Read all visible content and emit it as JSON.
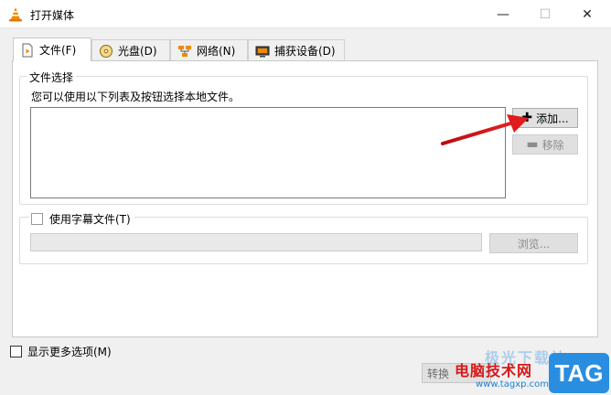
{
  "window": {
    "title": "打开媒体",
    "minimize_glyph": "—",
    "maximize_glyph": "☐",
    "close_glyph": "✕"
  },
  "tabs": [
    {
      "label": "文件(F)",
      "icon": "file-play-icon",
      "active": true
    },
    {
      "label": "光盘(D)",
      "icon": "disc-icon",
      "active": false
    },
    {
      "label": "网络(N)",
      "icon": "network-icon",
      "active": false
    },
    {
      "label": "捕获设备(D)",
      "icon": "capture-device-icon",
      "active": false
    }
  ],
  "file_selection": {
    "group_title": "文件选择",
    "description": "您可以使用以下列表及按钮选择本地文件。",
    "add_label": "添加...",
    "remove_label": "移除"
  },
  "subtitle": {
    "checkbox_label": "使用字幕文件(T)",
    "browse_label": "浏览..."
  },
  "bottom": {
    "more_options_label": "显示更多选项(M)",
    "convert_label": "转换"
  },
  "watermark": {
    "site_name": "电脑技术网",
    "url": "www.tagxp.com",
    "logo": "TAG",
    "faded_text": "极光下载站"
  },
  "colors": {
    "accent_red": "#d71818",
    "watermark_blue": "#2a8ee0",
    "vlc_orange": "#f08a00"
  }
}
